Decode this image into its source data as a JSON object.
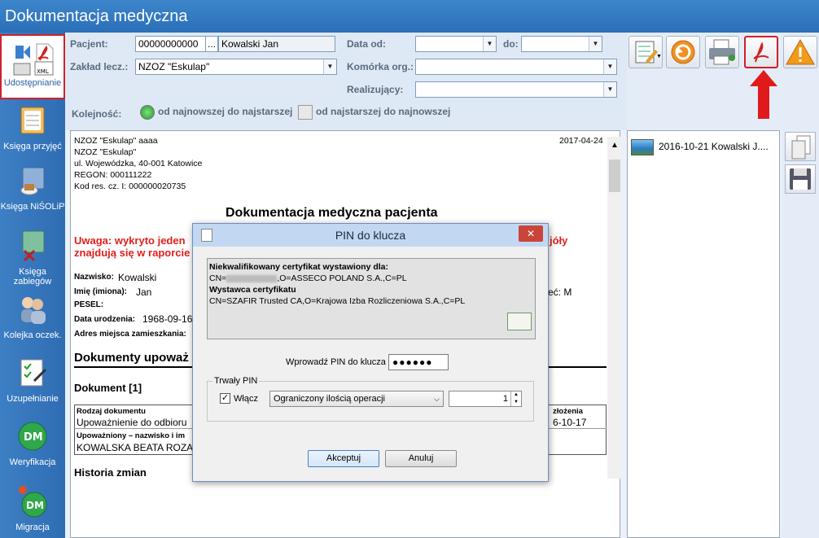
{
  "window": {
    "title": "Dokumentacja medyczna"
  },
  "sidebar": {
    "items": [
      {
        "label": "Udostępnianie",
        "active": true
      },
      {
        "label": "Księga przyjęć"
      },
      {
        "label": "Księga NiŚOLiP"
      },
      {
        "label": "Księga zabiegów"
      },
      {
        "label": "Kolejka oczek."
      },
      {
        "label": "Uzupełnianie"
      },
      {
        "label": "Weryfikacja"
      },
      {
        "label": "Migracja"
      }
    ],
    "xml_icon_text": "XML",
    "dm_icon_text": "DM"
  },
  "filters": {
    "patient_label": "Pacjent:",
    "patient_id": "00000000000",
    "patient_btn": "...",
    "patient_name": "Kowalski Jan",
    "facility_label": "Zakład lecz.:",
    "facility_value": "NZOZ \"Eskulap\"",
    "date_from_label": "Data od:",
    "date_to_label": "do:",
    "unit_label": "Komórka org.:",
    "realizing_label": "Realizujący:",
    "order_label": "Kolejność:",
    "order_newest": "od najnowszej do najstarszej",
    "order_oldest": "od najstarszej do najnowszej"
  },
  "document": {
    "header_lines": [
      "NZOZ \"Eskulap\" aaaa",
      "NZOZ \"Eskulap\"",
      "ul. Wojewódzka, 40-001 Katowice",
      "REGON: 000111222",
      "Kod res. cz. I: 000000020735"
    ],
    "date": "2017-04-24",
    "title": "Dokumentacja medyczna pacjenta",
    "warning_line1_left": "Uwaga: wykryto jeden",
    "warning_line1_right": "jóły",
    "warning_line2_left": "znajdują się w raporcie",
    "surname_label": "Nazwisko:",
    "surname_value": "Kowalski",
    "names_label": "Imię (imiona):",
    "names_value": "Jan",
    "sex_tail": "eć: M",
    "pesel_label": "PESEL:",
    "dob_label": "Data urodzenia:",
    "dob_value": "1968-09-16",
    "address_label": "Adres miejsca zamieszkania:",
    "section_docs": "Dokumenty upoważ",
    "doc1": "Dokument [1]",
    "tbl_type_label": "Rodzaj dokumentu",
    "tbl_type_value": "Upoważnienie do odbioru",
    "tbl_date_label": "złożenia",
    "tbl_date_value": "6-10-17",
    "tbl_auth_label": "Upoważniony – nazwisko i im",
    "tbl_auth_value": "KOWALSKA BEATA ROZA",
    "history": "Historia zmian"
  },
  "right_panel": {
    "items": [
      {
        "label": "2016-10-21 Kowalski J...."
      }
    ]
  },
  "dialog": {
    "title": "PIN do klucza",
    "close": "✕",
    "cert_for_label": "Niekwalifikowany certyfikat wystawiony dla:",
    "cert_for_value": "CN=",
    "cert_for_value_tail": ",O=ASSECO POLAND S.A.,C=PL",
    "issuer_label": "Wystawca certyfikatu",
    "issuer_value": "CN=SZAFIR Trusted CA,O=Krajowa Izba Rozliczeniowa S.A.,C=PL",
    "pin_label": "Wprowadź PIN do klucza",
    "pin_value": "●●●●●●",
    "persistent_label": "Trwały PIN",
    "enable_label": "Włącz",
    "checked_mark": "✓",
    "mode_value": "Ograniczony ilością operacji",
    "count_value": "1",
    "accept": "Akceptuj",
    "cancel": "Anuluj"
  },
  "colors": {
    "title_bar": "#3d86cc",
    "sidebar": "#2f6db3",
    "highlight": "#d0202a",
    "warning": "#e0201c"
  }
}
